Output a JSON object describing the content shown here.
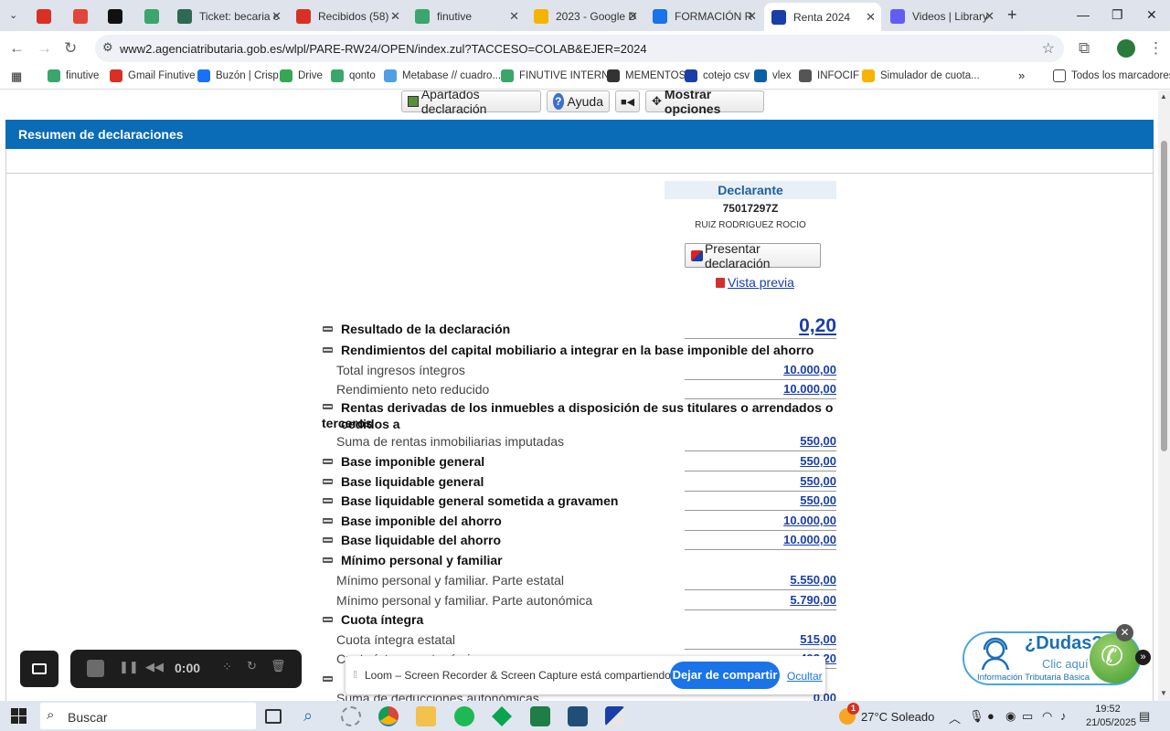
{
  "browser": {
    "tabs": [
      {
        "label": "",
        "icon": "chrome-icon"
      },
      {
        "label": "",
        "icon": "red-document-icon"
      },
      {
        "label": "",
        "icon": "notion-icon"
      },
      {
        "label": "",
        "icon": "finutive-icon"
      },
      {
        "label": "Ticket: becaria c",
        "icon": "ticket-icon"
      },
      {
        "label": "Recibidos (58) -",
        "icon": "gmail-icon"
      },
      {
        "label": "finutive",
        "icon": "finutive-icon"
      },
      {
        "label": "2023 - Google D",
        "icon": "google-drive-icon"
      },
      {
        "label": "FORMACIÓN R",
        "icon": "docs-icon"
      },
      {
        "label": "Renta 2024",
        "icon": "aeat-icon"
      },
      {
        "label": "Videos | Library",
        "icon": "loom-icon"
      }
    ],
    "url": "www2.agenciatributaria.gob.es/wlpl/PARE-RW24/OPEN/index.zul?TACCESO=COLAB&EJER=2024",
    "bookmarks": [
      {
        "label": "finutive",
        "color": "#3aa66b"
      },
      {
        "label": "Gmail Finutive",
        "color": "#d93025"
      },
      {
        "label": "Buzón | Crisp",
        "color": "#1972f5"
      },
      {
        "label": "Drive",
        "color": "#34a853"
      },
      {
        "label": "qonto",
        "color": "#3aa66b"
      },
      {
        "label": "Metabase // cuadro...",
        "color": "#509ee3"
      },
      {
        "label": "FINUTIVE INTERNO",
        "color": "#3aa66b"
      },
      {
        "label": "MEMENTOS",
        "color": "#333333"
      },
      {
        "label": "cotejo csv",
        "color": "#1a3ea8"
      },
      {
        "label": "vlex",
        "color": "#0b5fa5"
      },
      {
        "label": "INFOCIF",
        "color": "#555555"
      },
      {
        "label": "Simulador de cuota...",
        "color": "#f5b400"
      }
    ],
    "all_bookmarks": "Todos los marcadores"
  },
  "toolbar": {
    "apartados": "Apartados declaración",
    "ayuda": "Ayuda",
    "mostrar": "Mostrar opciones"
  },
  "section_title": "Resumen de declaraciones",
  "declarante": {
    "title": "Declarante",
    "nif": "75017297Z",
    "name": "RUIZ RODRIGUEZ ROCIO",
    "presentar": "Presentar declaración",
    "vista_previa": "Vista previa"
  },
  "rows": [
    {
      "label": "Resultado de la declaración",
      "value": "0,20",
      "type": "bold big"
    },
    {
      "label": "Rendimientos del capital mobiliario a integrar en la base imponible del ahorro",
      "value": "",
      "type": "bold"
    },
    {
      "label": "Total ingresos íntegros",
      "value": "10.000,00",
      "type": "sub"
    },
    {
      "label": "Rendimiento neto reducido",
      "value": "10.000,00",
      "type": "sub"
    },
    {
      "label": "Rentas derivadas de los inmuebles a disposición de sus titulares o arrendados o cedidos a",
      "label2": "terceros",
      "value": "",
      "type": "bold twoline"
    },
    {
      "label": "Suma de rentas inmobiliarias imputadas",
      "value": "550,00",
      "type": "sub"
    },
    {
      "label": "Base imponible general",
      "value": "550,00",
      "type": "bold"
    },
    {
      "label": "Base liquidable general",
      "value": "550,00",
      "type": "bold"
    },
    {
      "label": "Base liquidable general sometida a gravamen",
      "value": "550,00",
      "type": "bold"
    },
    {
      "label": "Base imponible del ahorro",
      "value": "10.000,00",
      "type": "bold"
    },
    {
      "label": "Base liquidable del ahorro",
      "value": "10.000,00",
      "type": "bold"
    },
    {
      "label": "Mínimo personal y familiar",
      "value": "",
      "type": "bold"
    },
    {
      "label": "Mínimo personal y familiar. Parte estatal",
      "value": "5.550,00",
      "type": "sub"
    },
    {
      "label": "Mínimo personal y familiar. Parte autonómica",
      "value": "5.790,00",
      "type": "sub"
    },
    {
      "label": "Cuota íntegra",
      "value": "",
      "type": "bold"
    },
    {
      "label": "Cuota íntegra estatal",
      "value": "515,00",
      "type": "sub"
    },
    {
      "label": "Cuota íntegra autonómica",
      "value": "493,20",
      "type": "sub"
    },
    {
      "label": "",
      "value": "",
      "type": "bold"
    },
    {
      "label": "Suma de deducciones autonómicas",
      "value": "0,00",
      "type": "sub"
    }
  ],
  "loom": {
    "time": "0:00",
    "share_text": "Loom – Screen Recorder & Screen Capture está compartiendo tu pantalla.",
    "stop_share": "Dejar de compartir",
    "hide": "Ocultar"
  },
  "help_widget": {
    "question": "¿Dudas?",
    "click": "Clic aquí",
    "info": "Información Tributaria Básica"
  },
  "taskbar": {
    "search": "Buscar",
    "weather": "27°C  Soleado",
    "weather_badge": "1",
    "time": "19:52",
    "date": "21/05/2025"
  }
}
